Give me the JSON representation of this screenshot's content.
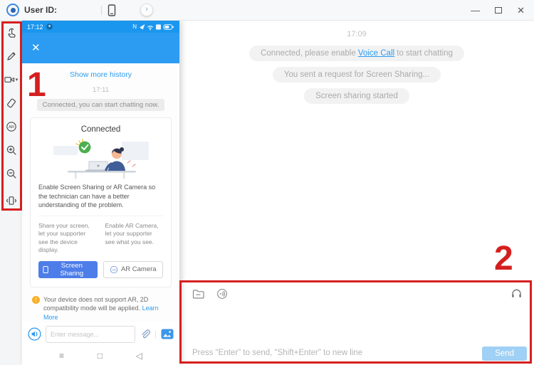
{
  "titlebar": {
    "title": "User ID:",
    "chevron_glyph": "›",
    "minimize_glyph": "—",
    "close_glyph": "✕",
    "icons": [
      "app-logo",
      "device-phone-icon",
      "expand-chevron-icon",
      "minimize-icon",
      "maximize-icon",
      "close-icon"
    ]
  },
  "sidebar": {
    "icons": [
      "gesture-control-icon",
      "draw-icon",
      "video-camera-icon",
      "rotate-screen-icon",
      "ar-icon",
      "zoom-in-icon",
      "zoom-out-icon",
      "vibrate-icon"
    ]
  },
  "phone": {
    "status": {
      "time": "17:12",
      "carrier_letter": "N",
      "notif_glyph": "◂"
    },
    "header": {
      "close_glyph": "✕"
    },
    "history_link": "Show more history",
    "time": "17:11",
    "status_pill": "Connected, you can start chatting now.",
    "card": {
      "title": "Connected",
      "description": "Enable Screen Sharing or AR Camera so the technician can have a better understanding of the problem.",
      "left_hint": "Share your screen, let your supporter see the device display.",
      "right_hint": "Enable AR Camera, let your supporter see what you see.",
      "screen_sharing_button": "Screen Sharing",
      "ar_camera_button": "AR Camera"
    },
    "warning": {
      "icon_glyph": "!",
      "text": "Your device does not support AR, 2D compatibility mode will be applied. ",
      "link": "Learn More"
    },
    "composer": {
      "placeholder": "Enter message...",
      "divider_glyph": "|"
    },
    "nav": {
      "menu": "≡",
      "home": "□",
      "back": "◁"
    }
  },
  "chat": {
    "time": "17:09",
    "pill1": {
      "prefix": "Connected, please enable ",
      "link": "Voice Call",
      "suffix": " to start chatting"
    },
    "pill2": "You sent a request for Screen Sharing...",
    "pill3": "Screen sharing started"
  },
  "composer": {
    "hint": "Press \"Enter\" to send, \"Shift+Enter\" to new line",
    "send_label": "Send",
    "icons": [
      "file-transfer-icon",
      "voice-call-icon",
      "headset-icon"
    ]
  },
  "annotations": {
    "label_one": "1",
    "label_two": "2"
  },
  "colors": {
    "accent": "#2b9cf2",
    "annotation_red": "#d51f1f",
    "primary_button": "#4d7de8",
    "send_disabled": "#9fd0f5",
    "success_green": "#4caf50",
    "warning_orange": "#f6b026"
  }
}
